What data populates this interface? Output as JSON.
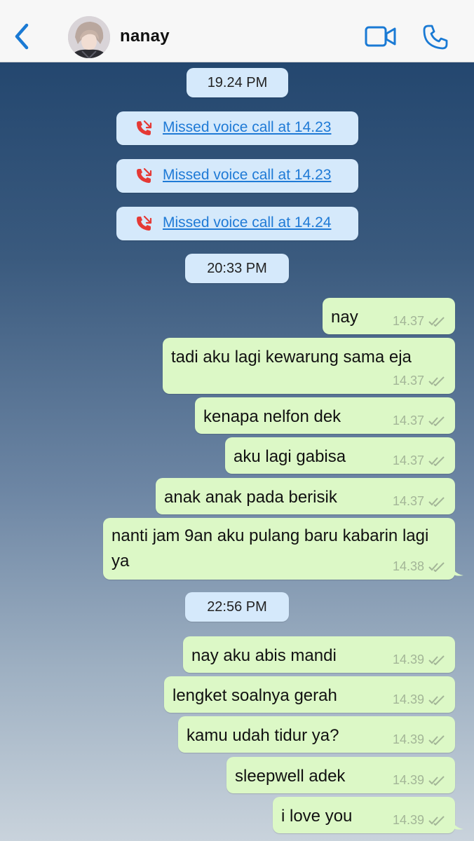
{
  "header": {
    "contact_name": "nanay",
    "back_icon": "chevron-left-icon",
    "video_icon": "video-camera-icon",
    "call_icon": "phone-icon",
    "accent_color": "#1a7ad4"
  },
  "chat": {
    "date_chips": [
      "19.24 PM",
      "20:33 PM",
      "22:56 PM"
    ],
    "missed_calls": [
      {
        "text": "Missed voice call at 14.23",
        "icon": "missed-call-icon"
      },
      {
        "text": "Missed voice call at 14.23",
        "icon": "missed-call-icon"
      },
      {
        "text": "Missed voice call at 14.24",
        "icon": "missed-call-icon"
      }
    ],
    "messages": [
      {
        "text": "nay",
        "time": "14.37"
      },
      {
        "text": "tadi aku lagi kewarung sama eja",
        "time": "14.37"
      },
      {
        "text": "kenapa nelfon dek",
        "time": "14.37"
      },
      {
        "text": "aku lagi gabisa",
        "time": "14.37"
      },
      {
        "text": "anak anak pada berisik",
        "time": "14.37"
      },
      {
        "text": "nanti jam 9an aku pulang baru kabarin lagi ya",
        "time": "14.38"
      },
      {
        "text": "nay aku abis mandi",
        "time": "14.39"
      },
      {
        "text": "lengket soalnya gerah",
        "time": "14.39"
      },
      {
        "text": "kamu udah tidur ya?",
        "time": "14.39"
      },
      {
        "text": "sleepwell adek",
        "time": "14.39"
      },
      {
        "text": "i love you",
        "time": "14.39"
      }
    ],
    "bubble_color": "#dcf8c6",
    "chip_color": "#d5e9fb",
    "missed_text_color": "#1f7ad6",
    "missed_icon_color": "#e53935"
  }
}
